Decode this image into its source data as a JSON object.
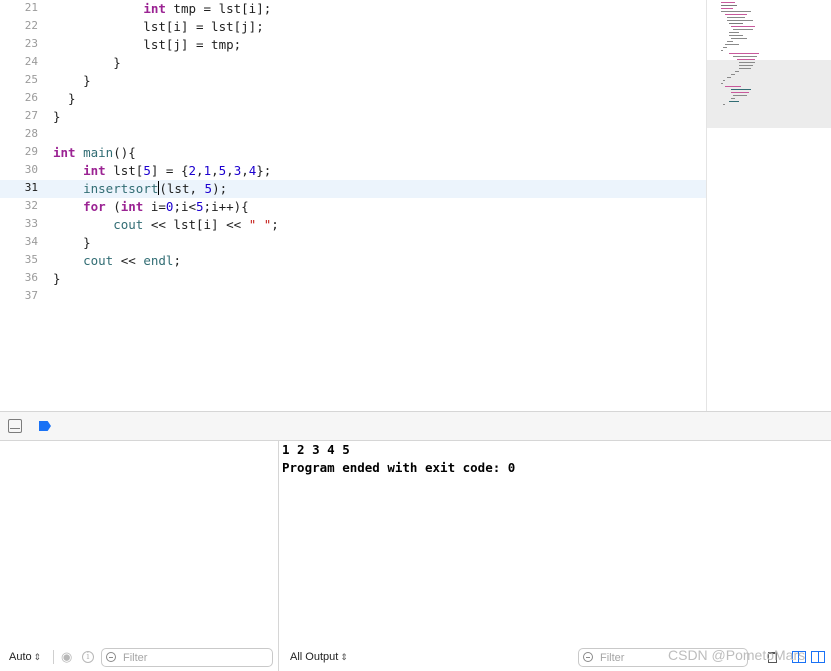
{
  "editor": {
    "current_line": 31,
    "lines": [
      {
        "n": "21",
        "code": [
          {
            "t": "            "
          },
          {
            "t": "int",
            "c": "kw"
          },
          {
            "t": " tmp = lst[i];"
          }
        ]
      },
      {
        "n": "22",
        "code": [
          {
            "t": "            lst[i] = lst[j];"
          }
        ]
      },
      {
        "n": "23",
        "code": [
          {
            "t": "            lst[j] = tmp;"
          }
        ]
      },
      {
        "n": "24",
        "code": [
          {
            "t": "        }"
          }
        ]
      },
      {
        "n": "25",
        "code": [
          {
            "t": "    }"
          }
        ]
      },
      {
        "n": "26",
        "code": [
          {
            "t": "  }"
          }
        ]
      },
      {
        "n": "27",
        "code": [
          {
            "t": "}"
          }
        ]
      },
      {
        "n": "28",
        "code": []
      },
      {
        "n": "29",
        "code": [
          {
            "t": "int",
            "c": "kw"
          },
          {
            "t": " "
          },
          {
            "t": "main",
            "c": "fn"
          },
          {
            "t": "(){"
          }
        ]
      },
      {
        "n": "30",
        "code": [
          {
            "t": "    "
          },
          {
            "t": "int",
            "c": "kw"
          },
          {
            "t": " lst["
          },
          {
            "t": "5",
            "c": "num"
          },
          {
            "t": "] = {"
          },
          {
            "t": "2",
            "c": "num"
          },
          {
            "t": ","
          },
          {
            "t": "1",
            "c": "num"
          },
          {
            "t": ","
          },
          {
            "t": "5",
            "c": "num"
          },
          {
            "t": ","
          },
          {
            "t": "3",
            "c": "num"
          },
          {
            "t": ","
          },
          {
            "t": "4",
            "c": "num"
          },
          {
            "t": "};"
          }
        ]
      },
      {
        "n": "31",
        "code": [
          {
            "t": "    "
          },
          {
            "t": "insertsort",
            "c": "fn"
          },
          {
            "t": "",
            "c": "caret"
          },
          {
            "t": "(lst, "
          },
          {
            "t": "5",
            "c": "num"
          },
          {
            "t": ");"
          }
        ]
      },
      {
        "n": "32",
        "code": [
          {
            "t": "    "
          },
          {
            "t": "for",
            "c": "kw"
          },
          {
            "t": " ("
          },
          {
            "t": "int",
            "c": "kw"
          },
          {
            "t": " i="
          },
          {
            "t": "0",
            "c": "num"
          },
          {
            "t": ";i<"
          },
          {
            "t": "5",
            "c": "num"
          },
          {
            "t": ";i++){"
          }
        ]
      },
      {
        "n": "33",
        "code": [
          {
            "t": "        "
          },
          {
            "t": "cout",
            "c": "fn"
          },
          {
            "t": " << lst[i] << "
          },
          {
            "t": "\" \"",
            "c": "str"
          },
          {
            "t": ";"
          }
        ]
      },
      {
        "n": "34",
        "code": [
          {
            "t": "    }"
          }
        ]
      },
      {
        "n": "35",
        "code": [
          {
            "t": "    "
          },
          {
            "t": "cout",
            "c": "fn"
          },
          {
            "t": " << "
          },
          {
            "t": "endl",
            "c": "fn"
          },
          {
            "t": ";"
          }
        ]
      },
      {
        "n": "36",
        "code": [
          {
            "t": "}"
          }
        ]
      },
      {
        "n": "37",
        "code": []
      }
    ]
  },
  "console": {
    "output": "1 2 3 4 5\nProgram ended with exit code: 0"
  },
  "variables_bar": {
    "scope_label": "Auto",
    "filter_placeholder": "Filter"
  },
  "console_bar": {
    "output_selector": "All Output",
    "filter_placeholder": "Filter"
  },
  "watermark": "CSDN @PometoMars",
  "icons": {
    "hide_debug": "panel-toggle-icon",
    "breakpoints": "breakpoint-icon",
    "eye": "eye-icon",
    "info": "info-icon",
    "filter": "filter-icon",
    "trash": "trash-icon",
    "split": "split-view-icon"
  },
  "colors": {
    "keyword": "#9b2393",
    "function": "#326d74",
    "number": "#1c00cf",
    "string": "#c41a16",
    "current_line_bg": "#ecf4fc",
    "breakpoint_accent": "#1a72f5"
  }
}
